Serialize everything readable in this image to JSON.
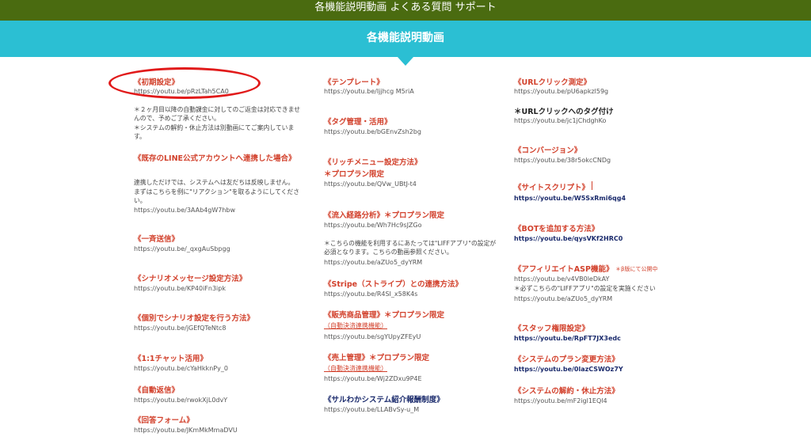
{
  "nav": {
    "links": "各機能説明動画 よくある質問 サポート"
  },
  "banner": {
    "title": "各機能説明動画"
  },
  "col1": [
    {
      "title": "《初期設定》",
      "url": "https://youtu.be/pRzLTah5CA0",
      "note1": "＊２ヶ月目以降の自動課金に対してのご返金は対応できませんので、予めご了承ください。",
      "note2": "＊システムの解約・休止方法は別動画にてご案内しています。"
    },
    {
      "title": "《既存のLINE公式アカウントへ連携した場合》",
      "note1": "連携しただけでは、システムへは友だちは反映しません。",
      "note2": "まずはこちらを例に\"リアクション\"を取るようにしてください。",
      "url": "https://youtu.be/3AAb4gW7hbw"
    },
    {
      "title": "《一斉送信》",
      "url": "https://youtu.be/_qxgAuSbpgg"
    },
    {
      "title": "《シナリオメッセージ設定方法》",
      "url": "https://youtu.be/KP40iFn3ipk"
    },
    {
      "title": "《個別でシナリオ設定を行う方法》",
      "url": "https://youtu.be/jGEfQTeNtc8"
    },
    {
      "title": "《1:1チャット活用》",
      "url": "https://youtu.be/cYaHkknPy_0"
    },
    {
      "title": "《自動返信》",
      "url": "https://youtu.be/rwokXjL0dvY"
    },
    {
      "title": "《回答フォーム》",
      "url": "https://youtu.be/JKmMkMmaDVU"
    }
  ],
  "col2": [
    {
      "title": "《テンプレート》",
      "url": "https://youtu.be/Ijjhcg M5riA"
    },
    {
      "title": "《タグ管理・活用》",
      "url": "https://youtu.be/bGEnvZsh2bg"
    },
    {
      "title": "《リッチメニュー設定方法》",
      "title2": "＊プロプラン限定",
      "url": "https://youtu.be/QVw_UBtJ-t4"
    },
    {
      "title": "《流入経路分析》＊プロプラン限定",
      "url": "https://youtu.be/Wh7Hc9sJZGo",
      "note1": "＊こちらの機能を利用するにあたっては\"LIFFアプリ\"の設定が必須となります。こちらの動画参照ください。",
      "url2": "https://youtu.be/aZUo5_dyYRM"
    },
    {
      "title": "《Stripe（ストライプ）との連携方法》",
      "url": "https://youtu.be/R4SI_x58K4s"
    },
    {
      "title": "《販売商品管理》＊プロプラン限定",
      "sub": "（自動決済連携機能）",
      "url": "https://youtu.be/sgYUpyZFEyU"
    },
    {
      "title": "《売上管理》＊プロプラン限定",
      "sub": "（自動決済連携機能）",
      "url": "https://youtu.be/Wj2ZDxu9P4E"
    },
    {
      "title": "《サルわかシステム紹介報酬制度》",
      "url": "https://youtu.be/LLABvSy-u_M"
    }
  ],
  "col3": [
    {
      "title": "《URLクリック測定》",
      "url": "https://youtu.be/pU6apkzl59g"
    },
    {
      "title": "＊URLクリックへのタグ付け",
      "url": "https://youtu.be/jc1jChdghKo"
    },
    {
      "title": "《コンバージョン》",
      "url": "https://youtu.be/38r5okcCNDg"
    },
    {
      "title": "《サイトスクリプト》",
      "url": "https://youtu.be/W5SxRmi6qg4"
    },
    {
      "title": "《BOTを追加する方法》",
      "url": "https://youtu.be/qysVKf2HRC0"
    },
    {
      "title": "《アフィリエイトASP機能》",
      "small": "＊β版にて公開中",
      "url": "https://youtu.be/v4VB0leDkAY",
      "note1": "＊必ずこちらの\"LIFFアプリ\"の設定を実施ください",
      "url2": "https://youtu.be/aZUo5_dyYRM"
    },
    {
      "title": "《スタッフ権限設定》",
      "url": "https://youtu.be/RpFT7JX3edc"
    },
    {
      "title": "《システムのプラン変更方法》",
      "url": "https://youtu.be/0lazCSWOz7Y"
    },
    {
      "title": "《システムの解約・休止方法》",
      "url": "https://youtu.be/mF2igl1EQl4"
    }
  ]
}
